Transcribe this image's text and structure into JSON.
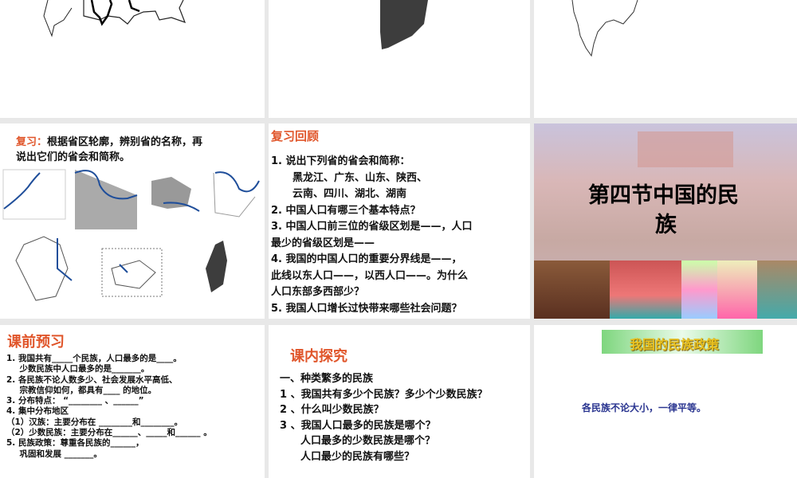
{
  "slides": [
    {
      "id": "top-left-maps"
    },
    {
      "id": "top-middle-map"
    },
    {
      "id": "top-right-map"
    },
    {
      "id": "review-maps",
      "label": "复习：",
      "text_line1": "根据省区轮廓，辨别省的名称，再",
      "text_line2": "说出它们的省会和简称。"
    },
    {
      "id": "review-questions",
      "title": "复习回顾",
      "lines": [
        "1. 说出下列省的省会和简称：",
        "　黑龙江、广东、山东、陕西、",
        "　云南、四川、湖北、湖南",
        "2. 中国人口有哪三个基本特点？",
        "3. 中国人口前三位的省级区划是——，人口",
        "最少的省级区划是——",
        "4. 我国的中国人口的重要分界线是——，",
        "此线以东人口——，以西人口——。为什么",
        "人口东部多西部少？",
        "5. 我国人口增长过快带来哪些社会问题？"
      ]
    },
    {
      "id": "title-slide",
      "title_line1": "第四节中国的民",
      "title_line2": "族"
    },
    {
      "id": "preview",
      "title": "课前预习",
      "lines": [
        "1. 我国共有_____个民族，人口最多的是____。",
        "　少数民族中人口最多的是_______。",
        "2. 各民族不论人数多少、社会发展水平高低、",
        "　宗教信仰如何，都具有____ 的地位。",
        "3. 分布特点： “________ 、______”",
        "4. 集中分布地区",
        "（1）汉族：主要分布在 ________和________。",
        "（2）少数民族：主要分布在______、_____和______ 。",
        "5. 民族政策：尊重各民族的______，",
        "　巩固和发展 _______。"
      ]
    },
    {
      "id": "explore",
      "title": "课内探究",
      "lines": [
        "一、种类繁多的民族",
        "1 、我国共有多少个民族？多少个少数民族？",
        "2 、什么叫少数民族？",
        "3 、我国人口最多的民族是哪个？",
        "　　人口最多的少数民族是哪个？",
        "　　人口最少的民族有哪些？"
      ]
    },
    {
      "id": "policy",
      "title": "我国的民族政策",
      "text": "各民族不论大小，一律平等。"
    }
  ],
  "colors": {
    "accent": "#e0552a",
    "policy_text": "#2a3590",
    "river": "#1f4e9a"
  }
}
